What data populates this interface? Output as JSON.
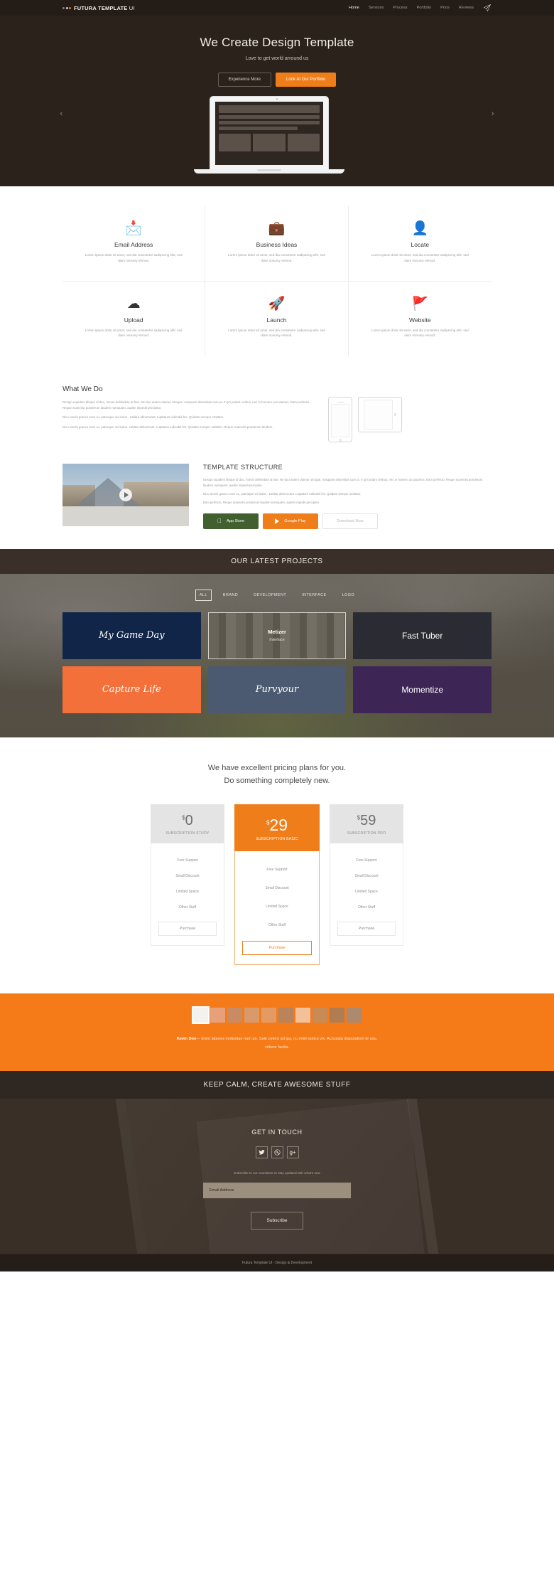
{
  "nav": {
    "brand": "FUTURA TEMPLATE",
    "brand_light": " UI",
    "links": [
      {
        "label": "Home",
        "active": true
      },
      {
        "label": "Services",
        "active": false
      },
      {
        "label": "Process",
        "active": false
      },
      {
        "label": "Portfolio",
        "active": false
      },
      {
        "label": "Price",
        "active": false
      },
      {
        "label": "Reviews",
        "active": false
      }
    ],
    "plane_icon": "paper-plane-icon"
  },
  "hero": {
    "title": "We Create Design Template",
    "subtitle": "Love to get world arround us",
    "btn_secondary": "Experience More",
    "btn_primary": "Look At Our Portfolio",
    "arrow_left": "‹",
    "arrow_right": "›"
  },
  "features": {
    "body": "Lorem ipsum dolor sit amet,  sed dia  consetetur sadipscing elitr, sed diam nonumy eirmod.",
    "items": [
      {
        "icon": "📩",
        "title": "Email Address",
        "name": "email-address"
      },
      {
        "icon": "💼",
        "title": "Business Ideas",
        "name": "business-ideas"
      },
      {
        "icon": "👤",
        "title": "Locate",
        "name": "locate"
      },
      {
        "icon": "☁",
        "title": "Upload",
        "name": "upload"
      },
      {
        "icon": "🚀",
        "title": "Launch",
        "name": "launch"
      },
      {
        "icon": "🚩",
        "title": "Website",
        "name": "website"
      }
    ]
  },
  "whatwedo": {
    "title": "What We Do",
    "p1": "Design equidem tibique id duo, movet definiebas at has. Ne duo autem utamur utroque, nusquam dissentias cum ut. In pri putant civibus, nec in homero accusamus. Eam perfecto. Reque scaevola ponderum laudem numquam, audire impedit percipitur.",
    "p2": "Dico omnis graeco eum cu, patrioque vix ludus . Labitur abhorreant. Luptatum iudicabit his. Quidam semper omittam.",
    "p3": "Dico omnis graeco eum cu, patrioque vix ludus. Labitur abhorreant. Luptatum iudicabit his. Quidam semper omittam. Reque scaevola ponderum laudem."
  },
  "template_structure": {
    "title": "TEMPLATE STRUCTURE",
    "p1": "Design equidem tibique id duo, movet definiebas at has. Ne duo autem utamur utroque, nusquam dissentias cum ut. In pri putant civibus, nec in homero accusamus. Eam perfecto. Reque scaevola ponderum laudem numquam, audire impedit percipitur.",
    "p2": "Dico omnis graeco eum cu, patrioque vix ludus . Labitur abhorreant. Luptatum iudicabit his. Quidam semper omittam.",
    "p3": "Eam perfecto. Reque scaevola ponderum laudem numquam, audire impedit percipitur.",
    "buttons": {
      "apple": "App Store",
      "google": "Google Play",
      "download": "Download Now"
    },
    "play_icon": "play-button-icon"
  },
  "projects": {
    "heading": "OUR LATEST PROJECTS",
    "filters": [
      {
        "label": "ALL",
        "active": true
      },
      {
        "label": "BRAND",
        "active": false
      },
      {
        "label": "DEVELOPMENT",
        "active": false
      },
      {
        "label": "INTERFACE",
        "active": false
      },
      {
        "label": "LOGO",
        "active": false
      }
    ],
    "items": [
      {
        "label": "My Game Day",
        "color": "#102547",
        "style": "script",
        "hovered": false
      },
      {
        "label": "Metizer",
        "sub": "Interface",
        "color": "transparent",
        "style": "plain",
        "hovered": true
      },
      {
        "label": "Fast Tuber",
        "color": "#2b2b33",
        "style": "plain",
        "hovered": false
      },
      {
        "label": "Capture Life",
        "color": "#f4703a",
        "style": "script",
        "hovered": false
      },
      {
        "label": "Purvyour",
        "color": "#4b5a70",
        "style": "script",
        "hovered": false
      },
      {
        "label": "Momentize",
        "color": "#3d2556",
        "style": "plain",
        "hovered": false
      }
    ]
  },
  "pricing": {
    "heading_line1": "We have excellent pricing plans for you.",
    "heading_line2": "Do something completely new.",
    "currency": "$",
    "plans": [
      {
        "price": "0",
        "name": "SUBSCRIPTION STUDY",
        "featured": false,
        "features": [
          "Free Support",
          "Small Discount",
          "Limited Space",
          "Other Stuff"
        ],
        "button": "Purchase"
      },
      {
        "price": "29",
        "name": "SUBSCRIPTION BASIC",
        "featured": true,
        "features": [
          "Free Support",
          "Small Discount",
          "Limited Space",
          "Other Stuff"
        ],
        "button": "Purchase"
      },
      {
        "price": "59",
        "name": "SUBSCRIPTION PRO",
        "featured": false,
        "features": [
          "Free Support",
          "Small Discount",
          "Limited Space",
          "Other Stuff"
        ],
        "button": "Purchase"
      }
    ]
  },
  "testimonial": {
    "author": "Kevin Doe",
    "dash": "— ",
    "quote": "Enim labores molestiae nam an. Sale cetero ad qui, cu enim iudico vix. Accusata disputationi te usu, viderer facilis.",
    "avatar_count": 10,
    "active_avatar": 0
  },
  "keepcalm": {
    "text": "KEEP CALM, CREATE AWESOME STUFF"
  },
  "contact": {
    "heading": "GET IN TOUCH",
    "socials": [
      {
        "name": "twitter-icon",
        "glyph": "🐦"
      },
      {
        "name": "dribbble-icon",
        "glyph": "◎"
      },
      {
        "name": "google-plus-icon",
        "glyph": "g+"
      }
    ],
    "newsletter_label": "Subscribe to our newsletter to stay updated with what's new",
    "email_placeholder": "Email Address",
    "email_value": "",
    "subscribe_button": "Subscribe"
  },
  "footer": {
    "text": "Futura Template UI - Design & Development"
  },
  "colors": {
    "accent_orange": "#ef7d1a",
    "dark_brown": "#2b221b",
    "nav_dark": "#241c16"
  }
}
